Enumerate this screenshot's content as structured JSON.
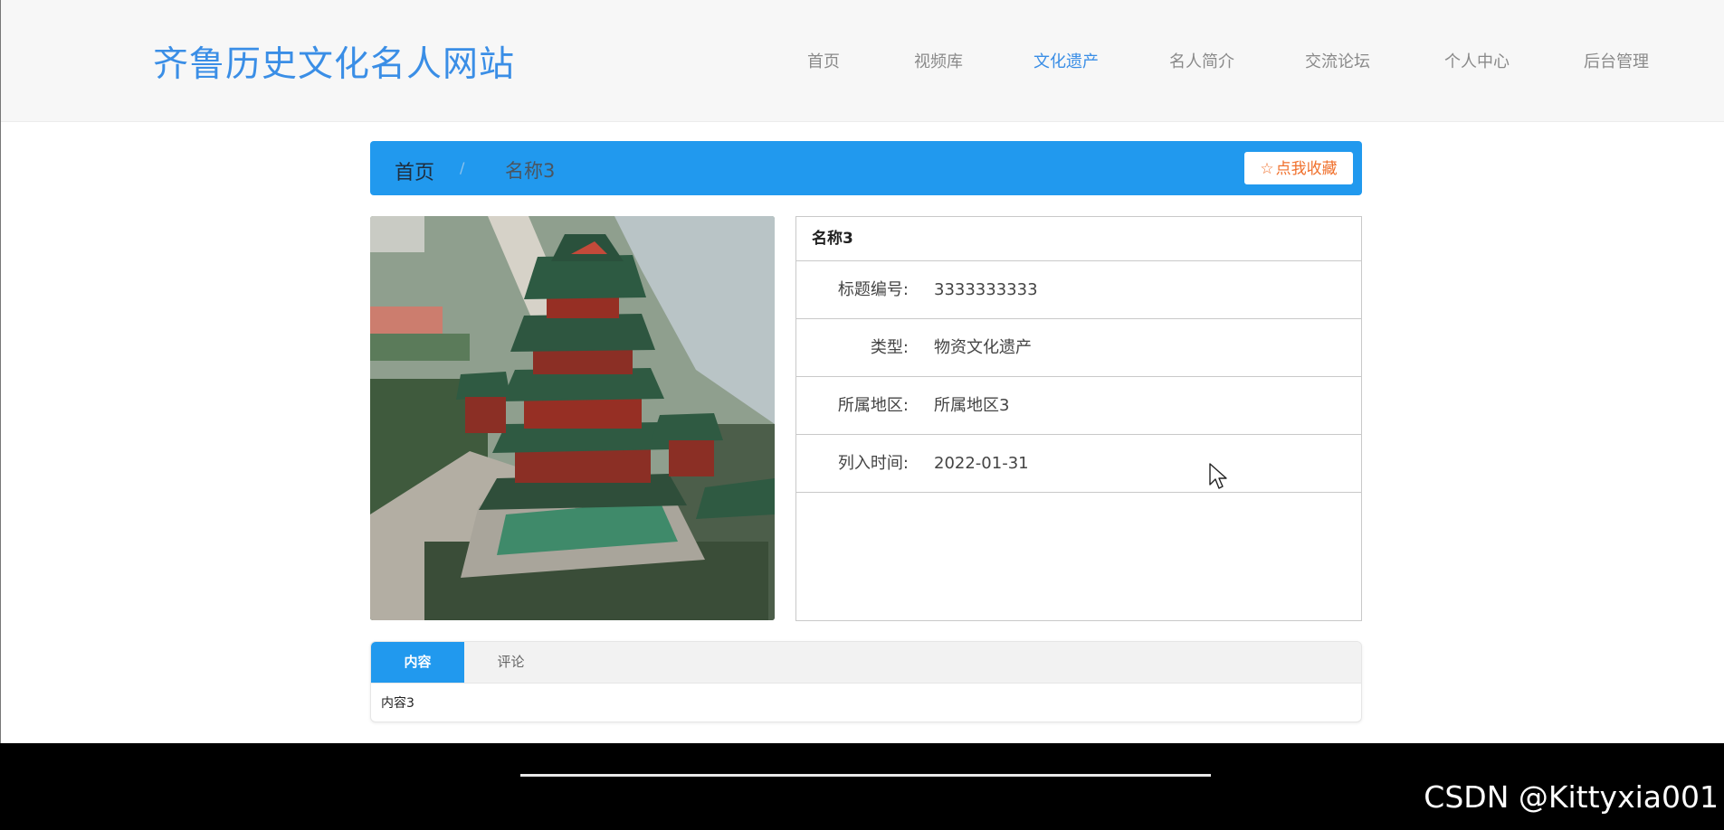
{
  "header": {
    "site_title": "齐鲁历史文化名人网站",
    "nav": [
      {
        "label": "首页",
        "active": false
      },
      {
        "label": "视频库",
        "active": false
      },
      {
        "label": "文化遗产",
        "active": true
      },
      {
        "label": "名人简介",
        "active": false
      },
      {
        "label": "交流论坛",
        "active": false
      },
      {
        "label": "个人中心",
        "active": false
      },
      {
        "label": "后台管理",
        "active": false
      }
    ],
    "accent_color": "#3a8ee6"
  },
  "breadcrumb": {
    "home": "首页",
    "separator": "/",
    "current": "名称3",
    "bar_color": "#2199ee"
  },
  "favorite_button": {
    "icon": "star-outline-icon",
    "label": "点我收藏",
    "color": "#f0702c"
  },
  "detail": {
    "image": "pavilion-photo",
    "name": "名称3",
    "fields": [
      {
        "label": "标题编号:",
        "value": "3333333333"
      },
      {
        "label": "类型:",
        "value": "物资文化遗产"
      },
      {
        "label": "所属地区:",
        "value": "所属地区3"
      },
      {
        "label": "列入时间:",
        "value": "2022-01-31"
      }
    ]
  },
  "tabs": {
    "items": [
      {
        "label": "内容",
        "active": true
      },
      {
        "label": "评论",
        "active": false
      }
    ],
    "content": "内容3"
  },
  "overlay": {
    "watermark": "CSDN @Kittyxia001"
  }
}
